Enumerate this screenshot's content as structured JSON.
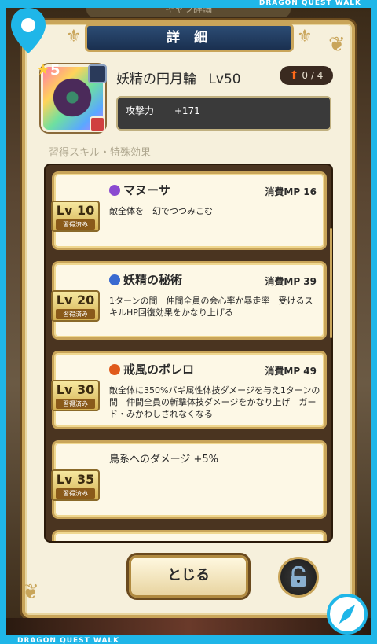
{
  "brand": {
    "top": "DRAGON QUEST WALK",
    "bottom": "DRAGON QUEST WALK"
  },
  "header_faded": "キャラ詳細",
  "title": "詳 細",
  "item": {
    "stars": "5",
    "name": "妖精の円月輪",
    "level": "Lv50",
    "upgrade": "0 / 4",
    "stat_label": "攻撃力",
    "stat_value": "+171"
  },
  "section_label": "習得スキル・特殊効果",
  "skills": [
    {
      "lv": "Lv 10",
      "learned": "習得済み",
      "name": "マヌーサ",
      "mp": "消費MP 16",
      "desc": "敵全体を　幻でつつみこむ",
      "orb_color": "#8a4ad0"
    },
    {
      "lv": "Lv 20",
      "learned": "習得済み",
      "name": "妖精の秘術",
      "mp": "消費MP 39",
      "desc": "1ターンの間　仲間全員の会心率か暴走率　受けるスキルHP回復効果をかなり上げる",
      "orb_color": "#3a6ad0"
    },
    {
      "lv": "Lv 30",
      "learned": "習得済み",
      "name": "戒風のボレロ",
      "mp": "消費MP 49",
      "desc": "敵全体に350%バギ属性体技ダメージを与え1ターンの間　仲間全員の斬撃体技ダメージをかなり上げ　ガード・みかわしされなくなる",
      "orb_color": "#e05a1a"
    },
    {
      "lv": "Lv 35",
      "learned": "習得済み",
      "name": "鳥系へのダメージ +5%",
      "mp": "",
      "desc": "",
      "orb_color": ""
    }
  ],
  "close_button": "とじる",
  "icons": {
    "pin": "map-pin-icon",
    "compass": "compass-icon",
    "lock": "unlock-icon",
    "upgrade": "arrow-up-icon"
  },
  "colors": {
    "frame": "#1fb6e8",
    "gold": "#c9a55a",
    "panel": "#f6f0dc",
    "banner": "#1a3050"
  }
}
